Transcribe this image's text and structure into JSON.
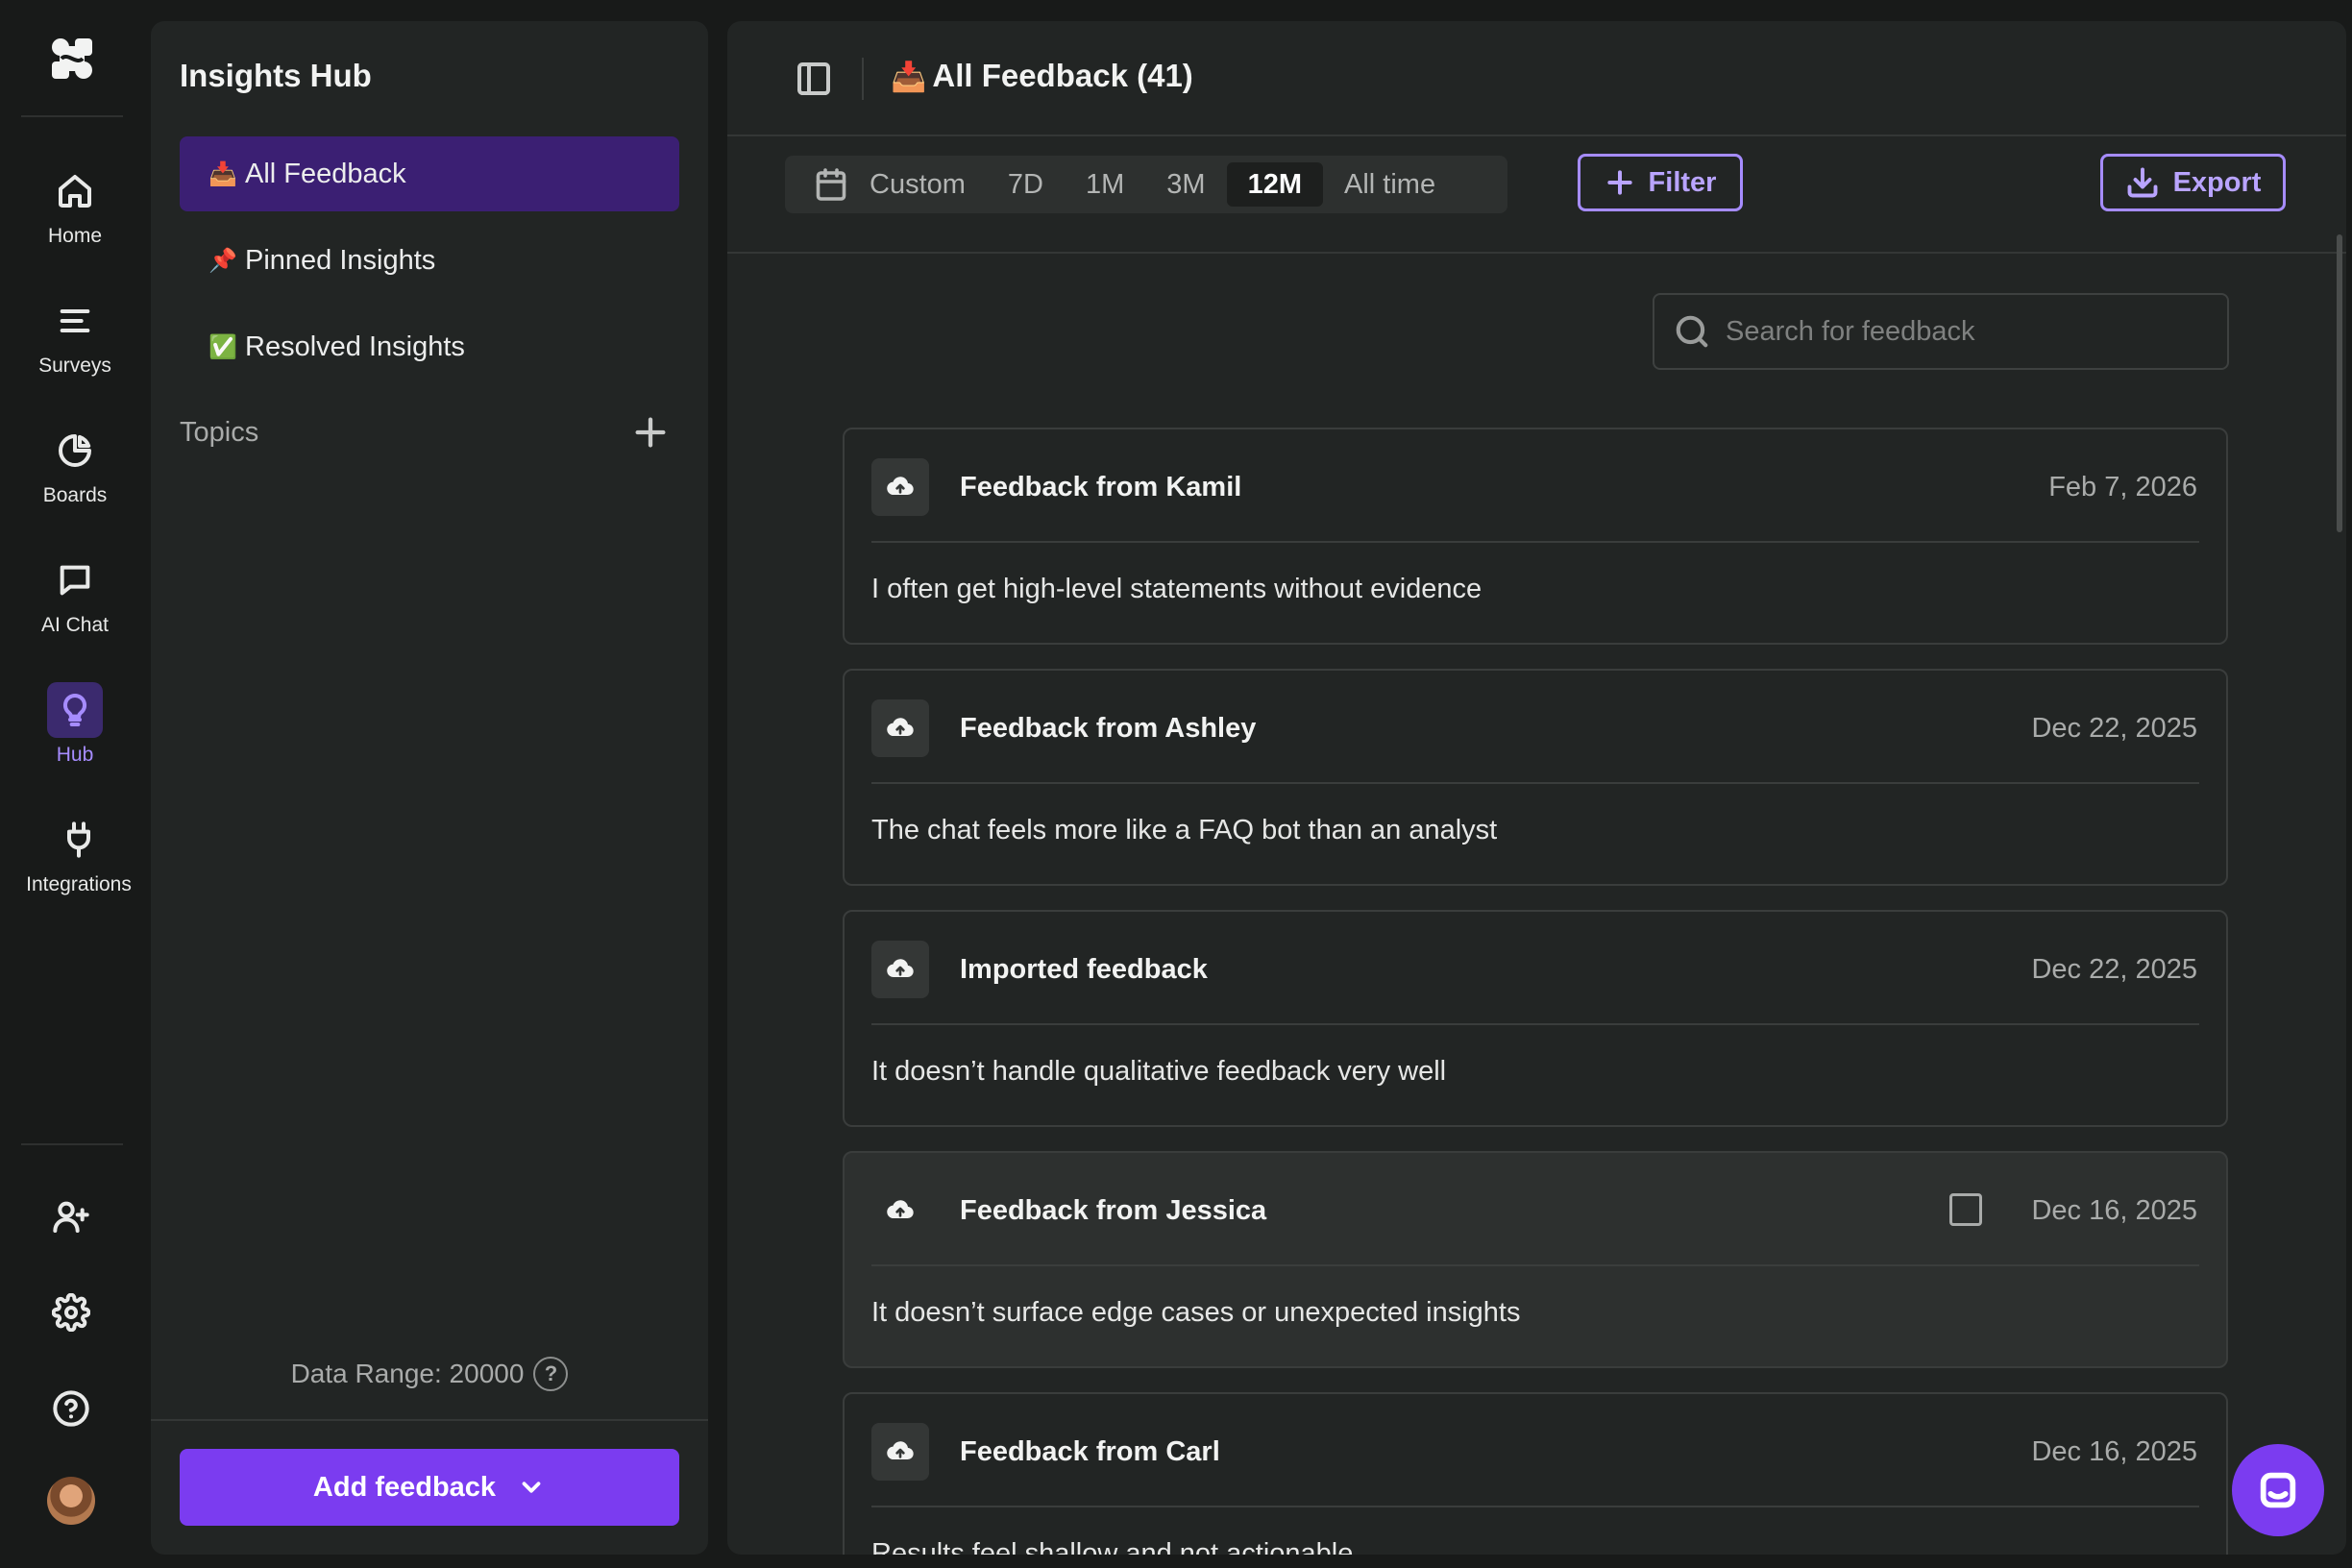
{
  "nav": {
    "items": [
      {
        "label": "Home",
        "icon": "home-icon"
      },
      {
        "label": "Surveys",
        "icon": "surveys-icon"
      },
      {
        "label": "Boards",
        "icon": "boards-icon"
      },
      {
        "label": "AI Chat",
        "icon": "chat-icon"
      },
      {
        "label": "Hub",
        "icon": "lightbulb-icon",
        "active": true
      },
      {
        "label": "Integrations",
        "icon": "plug-icon"
      }
    ]
  },
  "sidebar": {
    "title": "Insights Hub",
    "items": [
      {
        "emoji": "📥",
        "label": "All Feedback",
        "active": true
      },
      {
        "emoji": "📌",
        "label": "Pinned Insights"
      },
      {
        "emoji": "✅",
        "label": "Resolved Insights"
      }
    ],
    "topics_label": "Topics",
    "data_range": "Data Range: 20000",
    "help_glyph": "?",
    "add_feedback_label": "Add feedback"
  },
  "header": {
    "emoji": "📥",
    "title": "All Feedback (41)"
  },
  "filters": {
    "ranges": [
      "Custom",
      "7D",
      "1M",
      "3M",
      "12M",
      "All time"
    ],
    "active_range": "12M",
    "filter_label": "Filter",
    "export_label": "Export"
  },
  "search": {
    "placeholder": "Search for feedback"
  },
  "feedback": [
    {
      "title": "Feedback from Kamil",
      "date": "Feb 7, 2026",
      "body": "I often get high-level statements without evidence"
    },
    {
      "title": "Feedback from Ashley",
      "date": "Dec 22, 2025",
      "body": "The chat feels more like a FAQ bot than an analyst"
    },
    {
      "title": "Imported feedback",
      "date": "Dec 22, 2025",
      "body": "It doesn’t handle qualitative feedback very well"
    },
    {
      "title": "Feedback from Jessica",
      "date": "Dec 16, 2025",
      "body": "It doesn’t surface edge cases or unexpected insights"
    },
    {
      "title": "Feedback from Carl",
      "date": "Dec 16, 2025",
      "body": "Results feel shallow and not actionable"
    }
  ],
  "colors": {
    "accent": "#7b3cf0",
    "accent_light": "#a68cff",
    "active_item_bg": "#3b1f73",
    "panel_bg": "#222524",
    "app_bg": "#181a19"
  }
}
